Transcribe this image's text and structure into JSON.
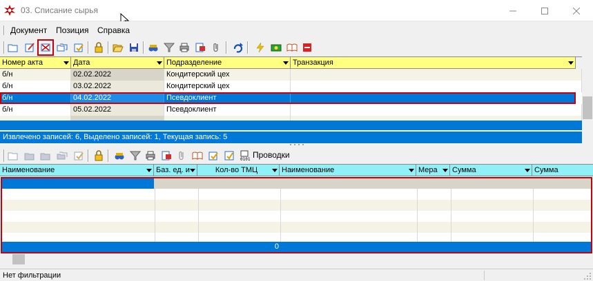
{
  "window": {
    "title": "03. Списание сырья"
  },
  "menu": {
    "items": [
      "Документ",
      "Позиция",
      "Справка"
    ]
  },
  "top_toolbar": {
    "icons": [
      "folder-new-icon",
      "edit-doc-icon",
      "delete-doc-icon",
      "folders-icon",
      "approve-doc-icon",
      "lock-icon",
      "open-folder-icon",
      "save-icon",
      "binoculars-icon",
      "filter-icon",
      "print-icon",
      "export-icon",
      "attach-icon",
      "refresh-icon",
      "lightning-icon",
      "money-icon",
      "book-icon",
      "stop-icon"
    ]
  },
  "documents": {
    "columns": [
      "Номер акта",
      "Дата",
      "Подразделение",
      "Транзакция"
    ],
    "rows": [
      {
        "number": "б/н",
        "date": "02.02.2022",
        "department": "Кондитерский цех",
        "transaction": ""
      },
      {
        "number": "б/н",
        "date": "03.02.2022",
        "department": "Кондитерский цех",
        "transaction": ""
      },
      {
        "number": "б/н",
        "date": "04.02.2022",
        "department": "Псевдоклиент",
        "transaction": ""
      },
      {
        "number": "б/н",
        "date": "05.02.2022",
        "department": "Псевдоклиент",
        "transaction": ""
      }
    ],
    "status": "Извлечено записей: 6, Выделено записей: 1, Текущая запись: 5"
  },
  "bottom_toolbar": {
    "postings_label": "Проводки"
  },
  "items": {
    "columns": [
      "Наименование",
      "Баз. ед. и",
      "Кол-во ТМЦ",
      "Наименование",
      "Мера",
      "Сумма",
      "Сумма"
    ],
    "total_quantity": "0"
  },
  "statusbar": {
    "text": "Нет фильтрации"
  },
  "colors": {
    "header_bg": "#ffff80",
    "header_bg_lower": "#90f0f8",
    "selection": "#0078d7",
    "highlight_border": "#c6000b",
    "row_alt": "#f5f3e6"
  }
}
